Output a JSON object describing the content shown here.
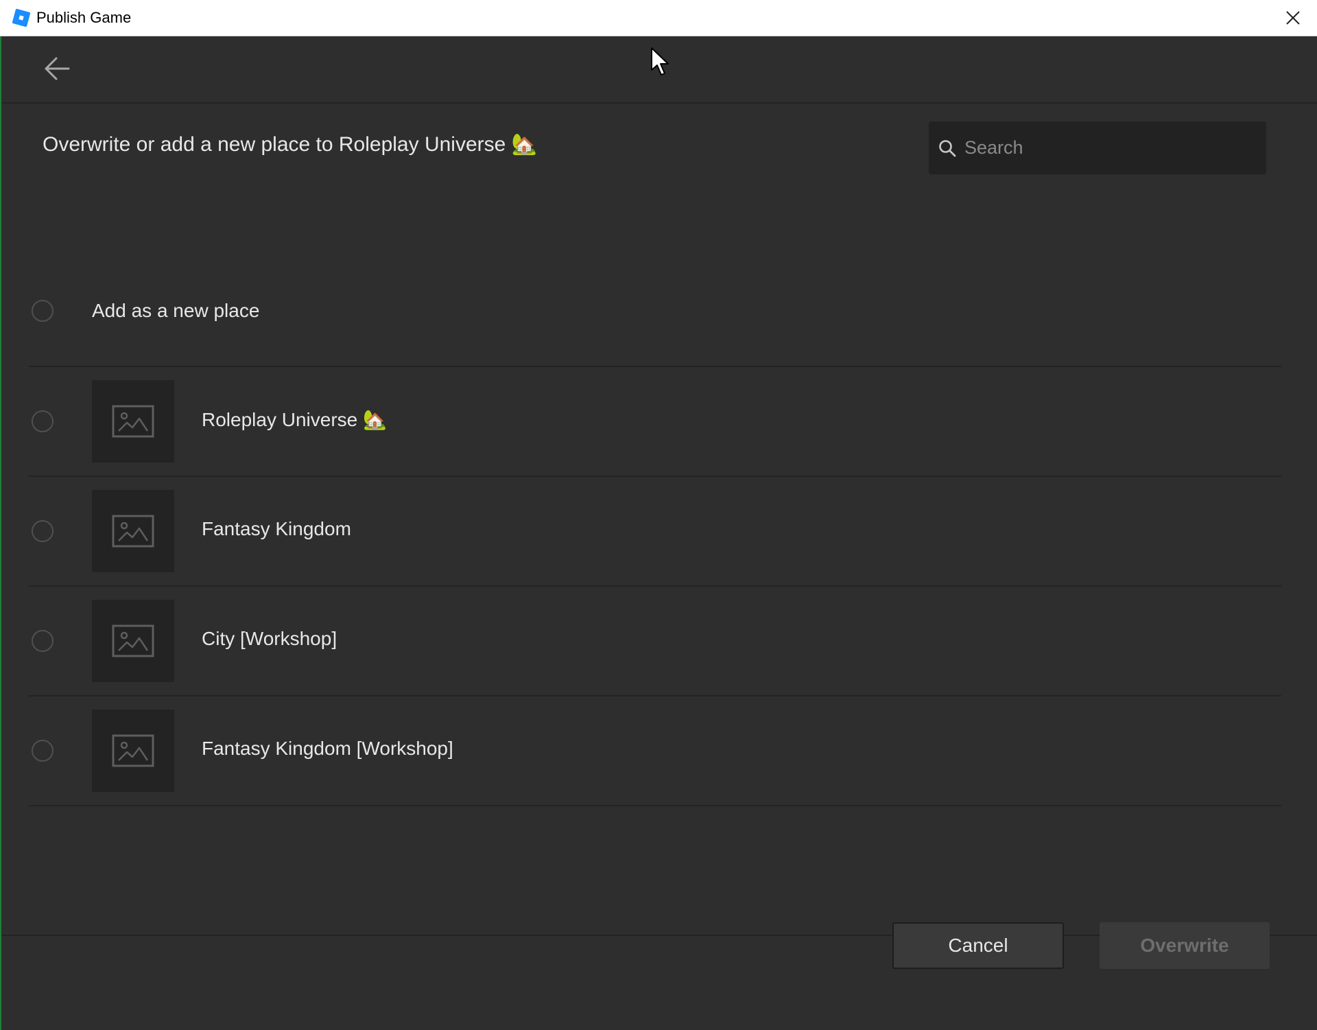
{
  "window": {
    "title": "Publish Game",
    "close_icon": "close-icon",
    "logo_icon": "roblox-studio-logo-icon"
  },
  "header": {
    "back_icon": "arrow-left-icon"
  },
  "main": {
    "heading": "Overwrite or add a new place to Roleplay Universe 🏡",
    "search": {
      "placeholder": "Search",
      "value": ""
    },
    "new_place_option": {
      "label": "Add as a new place",
      "selected": false
    },
    "places": [
      {
        "name": "Roleplay Universe 🏡",
        "thumbnail_icon": "image-placeholder-icon",
        "selected": false
      },
      {
        "name": "Fantasy Kingdom",
        "thumbnail_icon": "image-placeholder-icon",
        "selected": false
      },
      {
        "name": "City [Workshop]",
        "thumbnail_icon": "image-placeholder-icon",
        "selected": false
      },
      {
        "name": "Fantasy Kingdom [Workshop]",
        "thumbnail_icon": "image-placeholder-icon",
        "selected": false
      }
    ]
  },
  "footer": {
    "cancel_label": "Cancel",
    "overwrite_label": "Overwrite",
    "overwrite_enabled": false
  },
  "colors": {
    "background": "#2e2e2e",
    "titlebar": "#ffffff",
    "accent": "#1a8dff",
    "text": "#e8e8e8",
    "muted_text": "#8a8a8a",
    "disabled_text": "#6e6e6e"
  }
}
